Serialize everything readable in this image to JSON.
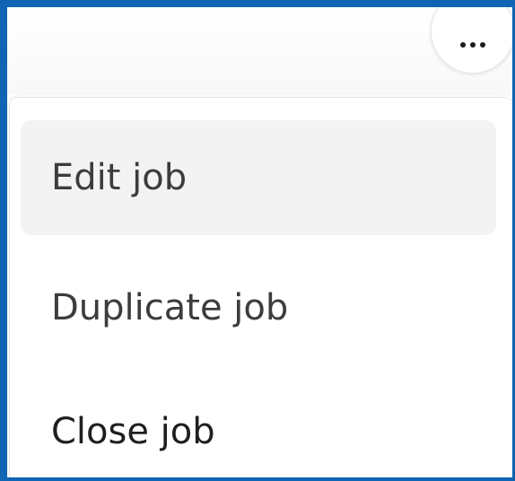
{
  "toolbar": {
    "more_icon": "horizontal-ellipsis-icon"
  },
  "menu": {
    "items": [
      {
        "label": "Edit job",
        "highlighted": true
      },
      {
        "label": "Duplicate job",
        "highlighted": false
      },
      {
        "label": "Close job",
        "highlighted": false
      }
    ]
  },
  "colors": {
    "frame_border": "#0f64b4",
    "hover_background": "#f3f3f4",
    "text_muted": "#3c3c3c",
    "text_strong": "#1f1f1f"
  }
}
